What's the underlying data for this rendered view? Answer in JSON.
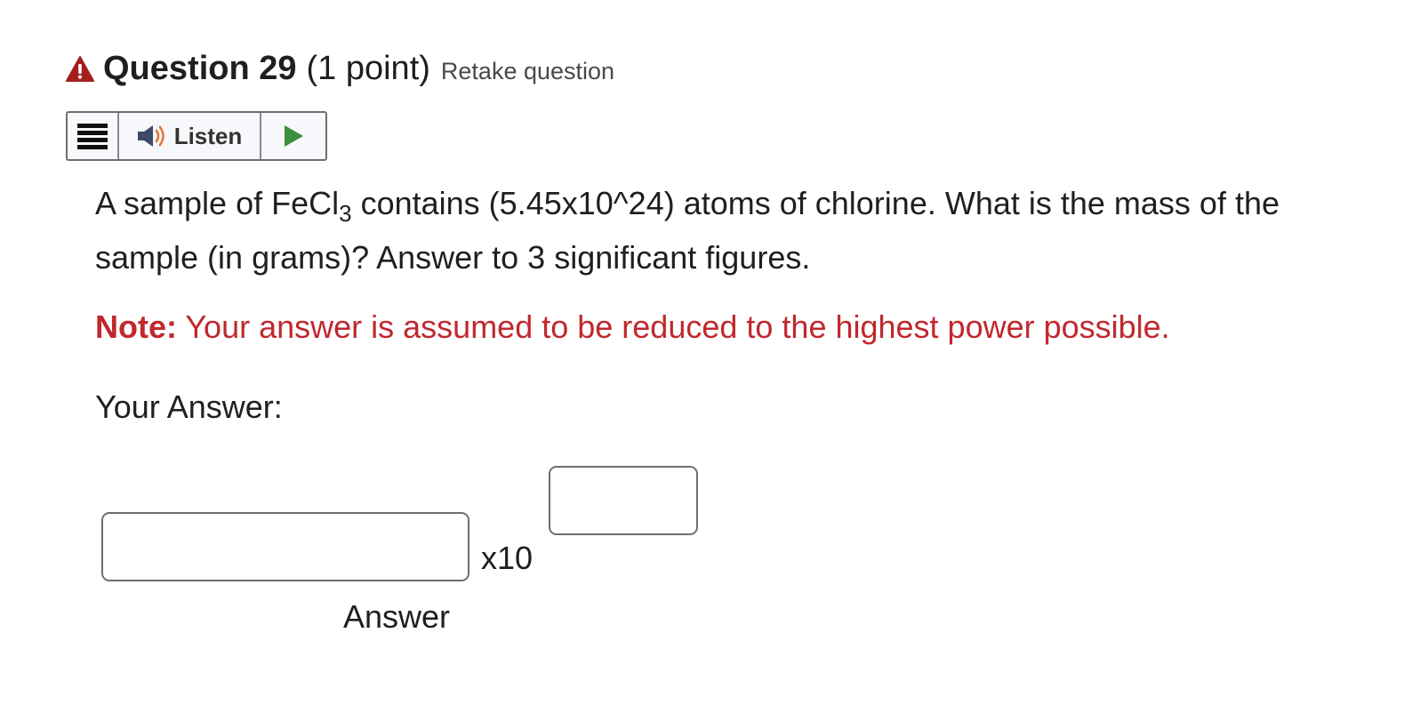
{
  "question": {
    "title": "Question 29",
    "points": "(1 point)",
    "retake_label": "Retake question",
    "status_icon": "warning-icon",
    "status_color": "#a31f1f"
  },
  "listen_toolbar": {
    "menu_icon": "menu-icon",
    "speaker_icon": "speaker-icon",
    "listen_label": "Listen",
    "play_icon": "play-icon",
    "play_color": "#3e8e41"
  },
  "body": {
    "text_before_formula": "A sample of FeCl",
    "formula_subscript": "3",
    "text_after_formula": " contains (5.45x10^24) atoms of chlorine.  What is the mass of the sample (in grams)? Answer to 3 significant figures."
  },
  "note": {
    "label": "Note:",
    "text": " Your answer is assumed to be reduced to the highest power possible.",
    "color": "#c0282d"
  },
  "answer": {
    "heading": "Your Answer:",
    "mantissa_value": "",
    "times_ten_label": "x10",
    "exponent_value": "",
    "caption": "Answer"
  }
}
